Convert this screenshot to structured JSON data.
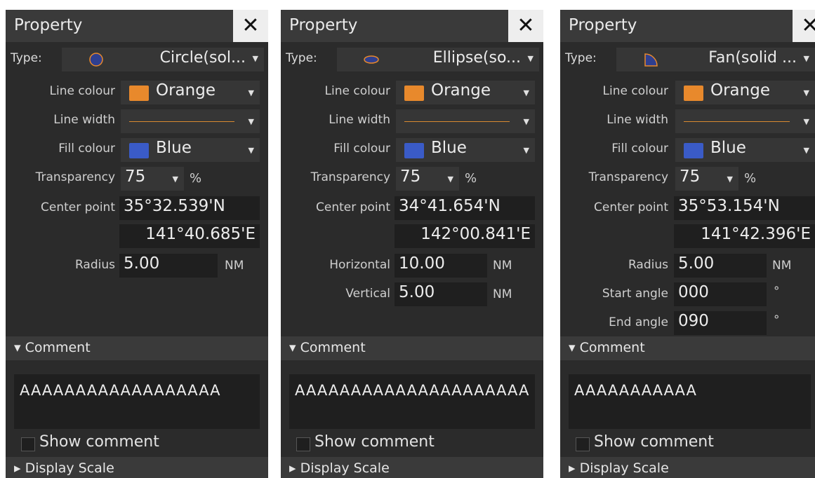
{
  "panels": [
    {
      "title": "Property",
      "close": "✕",
      "type_label": "Type:",
      "type_value": "Circle(sol...",
      "type_icon": "circle-icon",
      "line_colour_label": "Line colour",
      "line_colour_value": "Orange",
      "line_width_label": "Line width",
      "fill_colour_label": "Fill colour",
      "fill_colour_value": "Blue",
      "transparency_label": "Transparency",
      "transparency_value": "75",
      "transparency_unit": "%",
      "center_point_label": "Center point",
      "lat": "35°32.539'N",
      "lon": "141°40.685'E",
      "fields": [
        {
          "label": "Radius",
          "value": "5.00",
          "unit": "NM"
        }
      ],
      "comment_header": "Comment",
      "comment_text": "AAAAAAAAAAAAAAAAAA",
      "show_comment_label": "Show comment",
      "display_scale_header": "Display Scale"
    },
    {
      "title": "Property",
      "close": "✕",
      "type_label": "Type:",
      "type_value": "Ellipse(so...",
      "type_icon": "ellipse-icon",
      "line_colour_label": "Line colour",
      "line_colour_value": "Orange",
      "line_width_label": "Line width",
      "fill_colour_label": "Fill colour",
      "fill_colour_value": "Blue",
      "transparency_label": "Transparency",
      "transparency_value": "75",
      "transparency_unit": "%",
      "center_point_label": "Center point",
      "lat": "34°41.654'N",
      "lon": "142°00.841'E",
      "fields": [
        {
          "label": "Horizontal",
          "value": "10.00",
          "unit": "NM"
        },
        {
          "label": "Vertical",
          "value": "5.00",
          "unit": "NM"
        }
      ],
      "comment_header": "Comment",
      "comment_text": "AAAAAAAAAAAAAAAAAAAAA",
      "show_comment_label": "Show comment",
      "display_scale_header": "Display Scale"
    },
    {
      "title": "Property",
      "close": "✕",
      "type_label": "Type:",
      "type_value": "Fan(solid ...",
      "type_icon": "fan-icon",
      "line_colour_label": "Line colour",
      "line_colour_value": "Orange",
      "line_width_label": "Line width",
      "fill_colour_label": "Fill colour",
      "fill_colour_value": "Blue",
      "transparency_label": "Transparency",
      "transparency_value": "75",
      "transparency_unit": "%",
      "center_point_label": "Center point",
      "lat": "35°53.154'N",
      "lon": "141°42.396'E",
      "fields": [
        {
          "label": "Radius",
          "value": "5.00",
          "unit": "NM"
        },
        {
          "label": "Start angle",
          "value": "000",
          "unit": "°"
        },
        {
          "label": "End angle",
          "value": "090",
          "unit": "°"
        }
      ],
      "comment_header": "Comment",
      "comment_text": "AAAAAAAAAAA",
      "show_comment_label": "Show comment",
      "display_scale_header": "Display Scale"
    }
  ],
  "colors": {
    "orange": "#e8892c",
    "blue": "#3a5bc7",
    "panel_bg": "#2b2b2b",
    "field_bg": "#1f1f1f"
  }
}
